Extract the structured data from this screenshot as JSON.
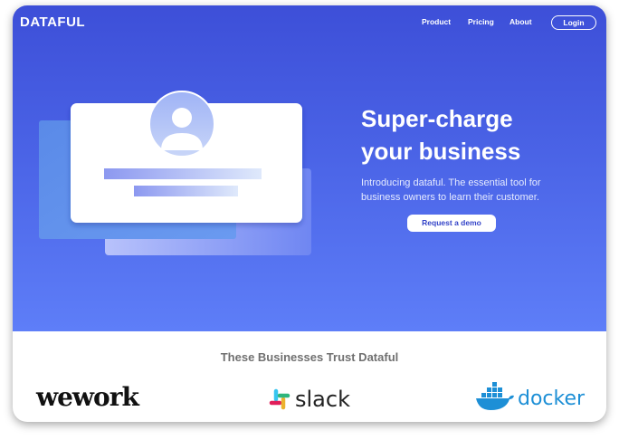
{
  "header": {
    "brand": "DATAFUL",
    "nav": [
      "Product",
      "Pricing",
      "About"
    ],
    "login_label": "Login"
  },
  "hero": {
    "title_line1": "Super-charge",
    "title_line2": "your business",
    "subtitle_line1": "Introducing dataful. The essential tool for",
    "subtitle_line2": "business owners to learn their customer.",
    "cta_label": "Request a demo"
  },
  "trust": {
    "heading": "These Businesses Trust Dataful",
    "logos": [
      {
        "name": "wework",
        "text": "wework",
        "icon": "wework-logo"
      },
      {
        "name": "slack",
        "text": "slack",
        "icon": "slack-logo-icon",
        "colors": [
          "#36c5f0",
          "#2eb67d",
          "#ecb22e",
          "#e01e5a"
        ]
      },
      {
        "name": "docker",
        "text": "docker",
        "icon": "docker-whale-icon",
        "color": "#1d8fd6"
      }
    ]
  },
  "colors": {
    "hero_top": "#3d4fd8",
    "hero_bottom": "#5e7ef8",
    "cta_text": "#3343c8"
  }
}
